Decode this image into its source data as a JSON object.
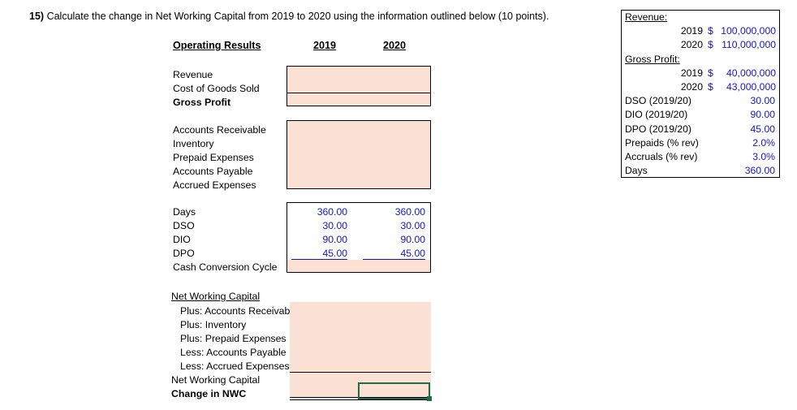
{
  "question": {
    "number": "15)",
    "text": "Calculate the change in Net Working Capital from 2019 to 2020 using the information outlined below (10 points)."
  },
  "worksheet": {
    "headers": {
      "section_label": "Operating Results",
      "col_2019": "2019",
      "col_2020": "2020"
    },
    "income_rows": [
      {
        "label": "Revenue",
        "bold": false
      },
      {
        "label": "Cost of Goods Sold",
        "bold": false
      },
      {
        "label": "Gross Profit",
        "bold": true
      }
    ],
    "balance_rows": [
      {
        "label": "Accounts Receivable"
      },
      {
        "label": "Inventory"
      },
      {
        "label": "Prepaid Expenses"
      },
      {
        "label": "Accounts Payable"
      },
      {
        "label": "Accrued Expenses"
      }
    ],
    "ratio_rows": [
      {
        "label": "Days",
        "v2019": "360.00",
        "v2020": "360.00"
      },
      {
        "label": "DSO",
        "v2019": "30.00",
        "v2020": "30.00"
      },
      {
        "label": "DIO",
        "v2019": "90.00",
        "v2020": "90.00"
      },
      {
        "label": "DPO",
        "v2019": "45.00",
        "v2020": "45.00"
      },
      {
        "label": "Cash Conversion Cycle",
        "v2019": "",
        "v2020": ""
      }
    ],
    "nwc_title": "Net Working Capital ",
    "nwc_rows": [
      {
        "label": "Plus:  Accounts Receivable"
      },
      {
        "label": "Plus:  Inventory"
      },
      {
        "label": "Plus:  Prepaid Expenses"
      },
      {
        "label": "Less:  Accounts Payable"
      },
      {
        "label": "Less:  Accrued Expenses"
      }
    ],
    "nwc_total_label": "Net Working Capital",
    "nwc_change_label": "Change in NWC"
  },
  "assumptions": {
    "revenue_header": "Revenue:",
    "revenue": [
      {
        "year": "2019",
        "currency": "$",
        "amount": "100,000,000"
      },
      {
        "year": "2020",
        "currency": "$",
        "amount": "110,000,000"
      }
    ],
    "gross_profit_header": "Gross Profit:",
    "gross_profit": [
      {
        "year": "2019",
        "currency": "$",
        "amount": "40,000,000"
      },
      {
        "year": "2020",
        "currency": "$",
        "amount": "43,000,000"
      }
    ],
    "metrics": [
      {
        "label": "DSO (2019/20)",
        "value": "30.00"
      },
      {
        "label": "DIO (2019/20)",
        "value": "90.00"
      },
      {
        "label": "DPO (2019/20)",
        "value": "45.00"
      },
      {
        "label": "Prepaids (% rev)",
        "value": "2.0%"
      },
      {
        "label": "Accruals (% rev)",
        "value": "3.0%"
      },
      {
        "label": "Days",
        "value": "360.00"
      }
    ]
  },
  "colors": {
    "input_fill": "#FBE0D4",
    "value_text": "#1414CC",
    "selection": "#1E6B47"
  }
}
